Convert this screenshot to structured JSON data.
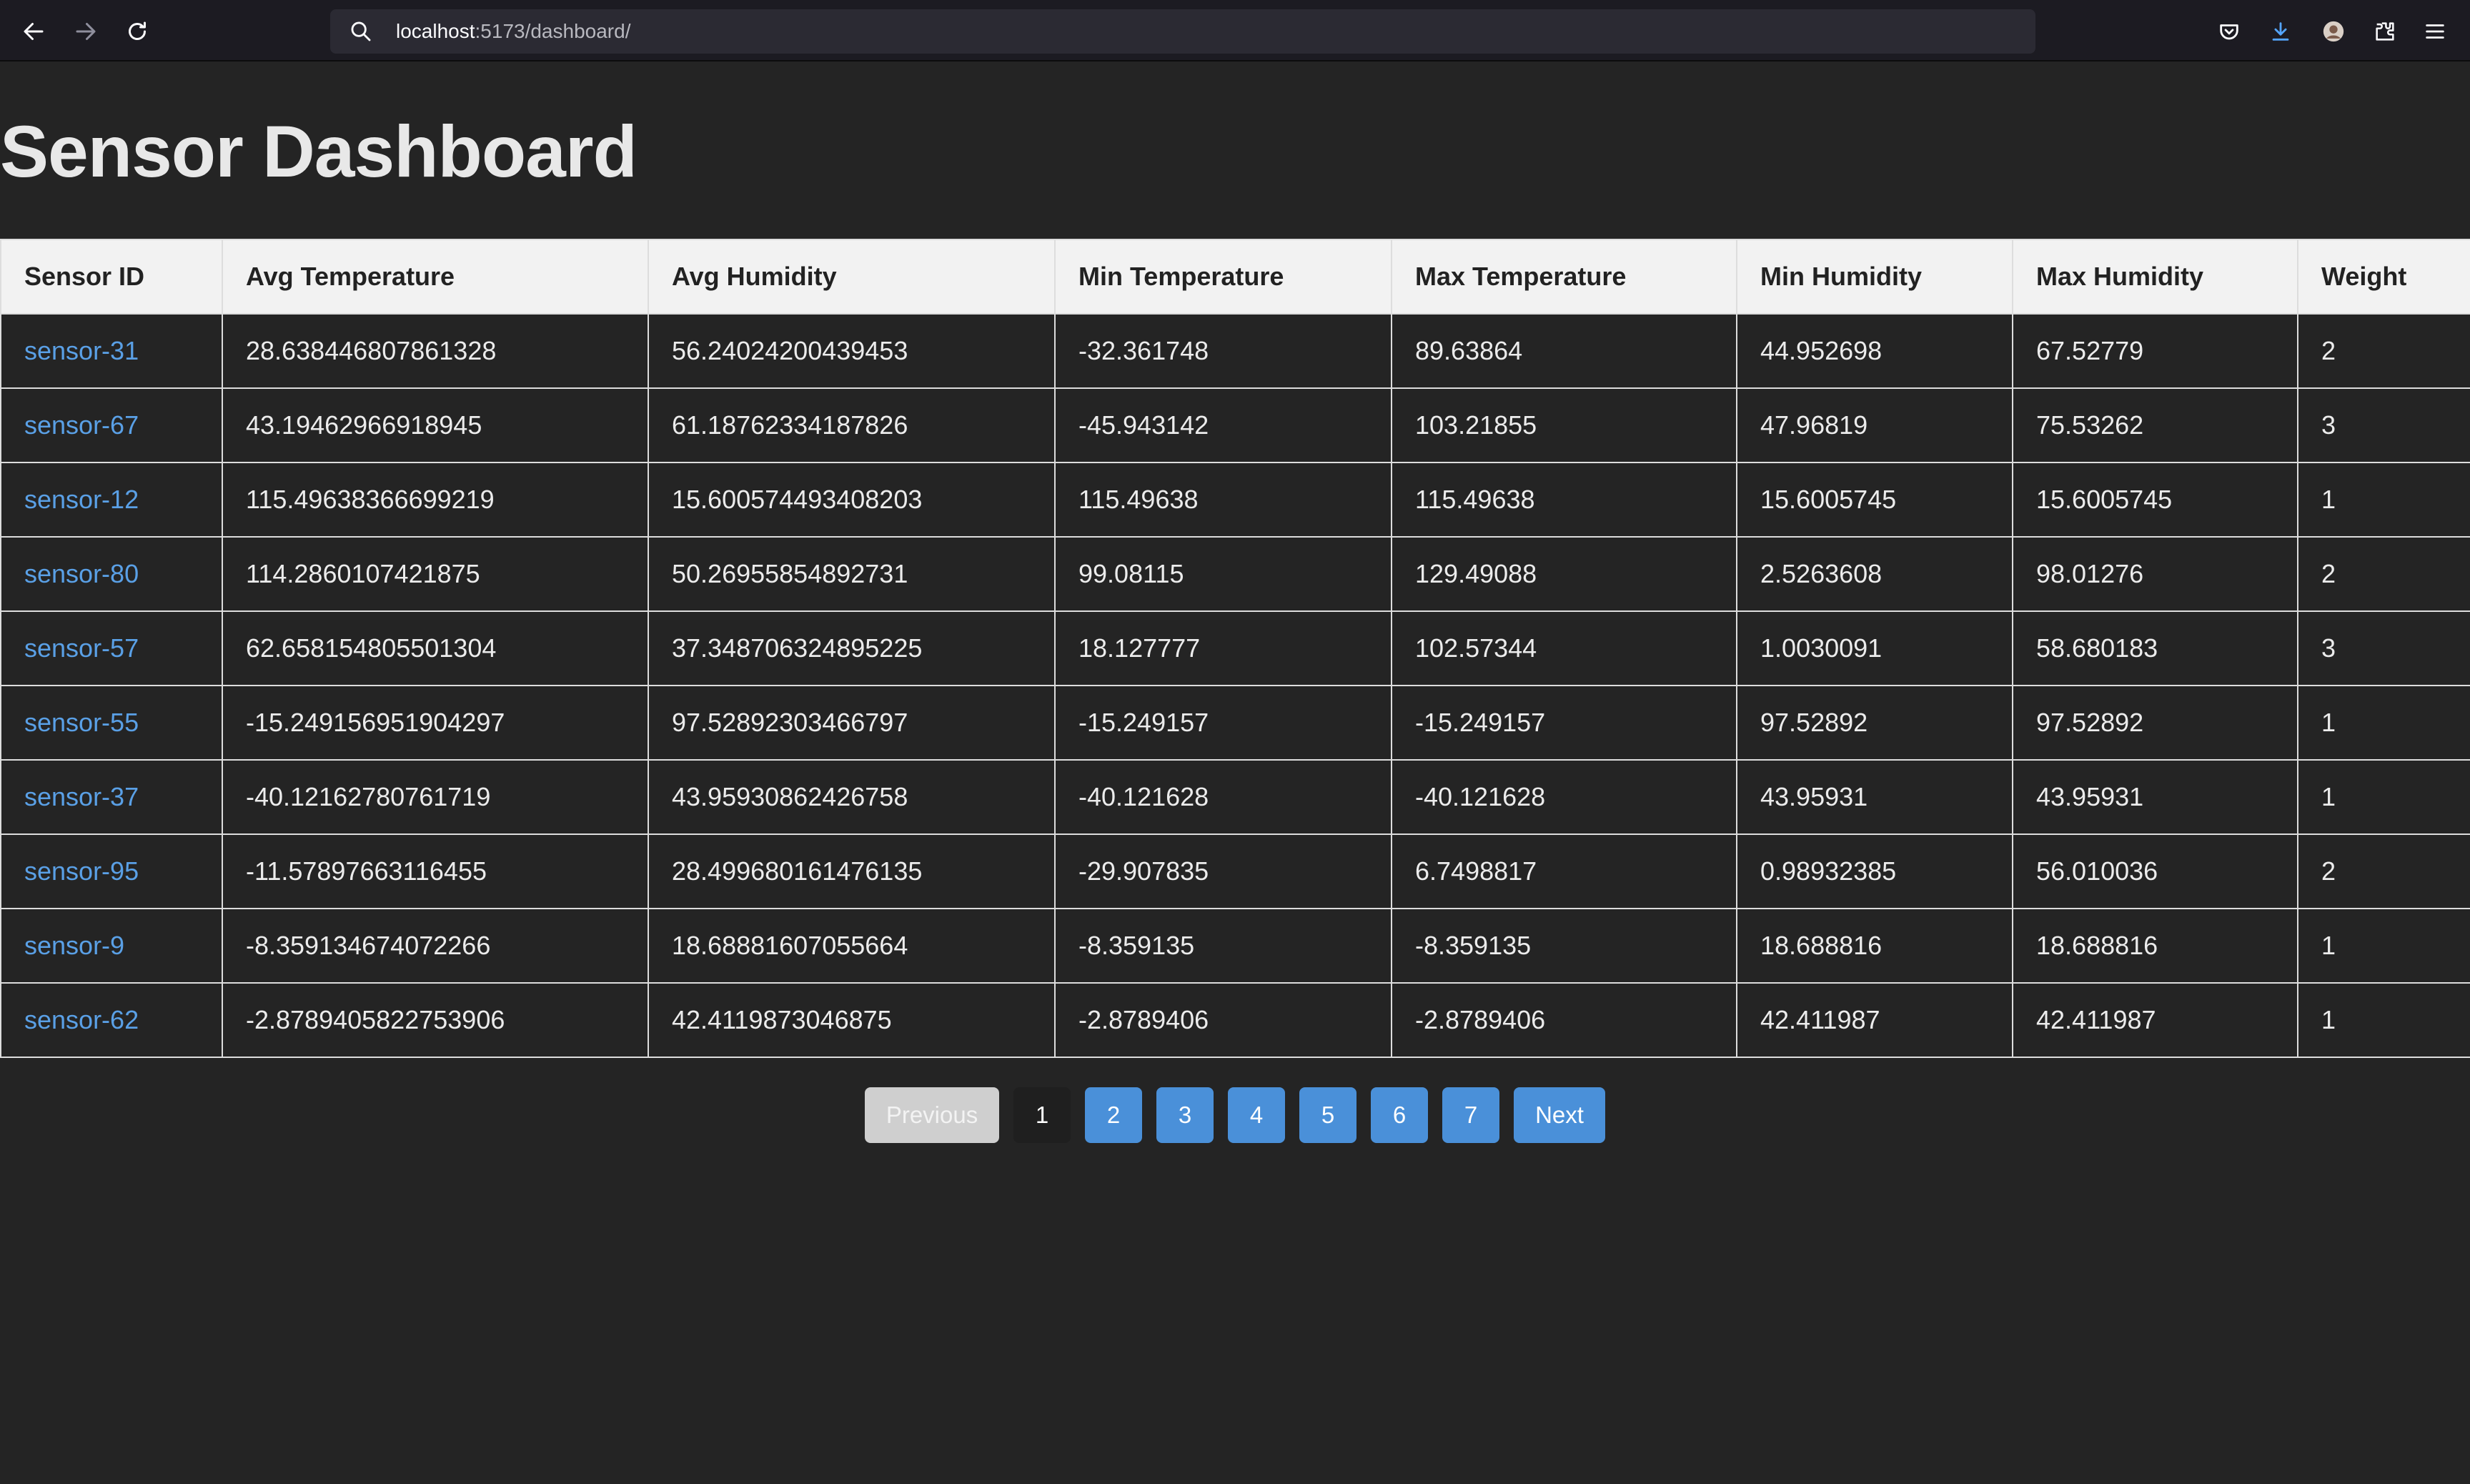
{
  "browser": {
    "url_host": "localhost",
    "url_path": ":5173/dashboard/"
  },
  "page": {
    "title": "Sensor Dashboard"
  },
  "table": {
    "headers": [
      "Sensor ID",
      "Avg Temperature",
      "Avg Humidity",
      "Min Temperature",
      "Max Temperature",
      "Min Humidity",
      "Max Humidity",
      "Weight"
    ],
    "rows": [
      [
        "sensor-31",
        "28.638446807861328",
        "56.24024200439453",
        "-32.361748",
        "89.63864",
        "44.952698",
        "67.52779",
        "2"
      ],
      [
        "sensor-67",
        "43.19462966918945",
        "61.18762334187826",
        "-45.943142",
        "103.21855",
        "47.96819",
        "75.53262",
        "3"
      ],
      [
        "sensor-12",
        "115.49638366699219",
        "15.600574493408203",
        "115.49638",
        "115.49638",
        "15.6005745",
        "15.6005745",
        "1"
      ],
      [
        "sensor-80",
        "114.2860107421875",
        "50.26955854892731",
        "99.08115",
        "129.49088",
        "2.5263608",
        "98.01276",
        "2"
      ],
      [
        "sensor-57",
        "62.658154805501304",
        "37.348706324895225",
        "18.127777",
        "102.57344",
        "1.0030091",
        "58.680183",
        "3"
      ],
      [
        "sensor-55",
        "-15.249156951904297",
        "97.52892303466797",
        "-15.249157",
        "-15.249157",
        "97.52892",
        "97.52892",
        "1"
      ],
      [
        "sensor-37",
        "-40.12162780761719",
        "43.95930862426758",
        "-40.121628",
        "-40.121628",
        "43.95931",
        "43.95931",
        "1"
      ],
      [
        "sensor-95",
        "-11.57897663116455",
        "28.499680161476135",
        "-29.907835",
        "6.7498817",
        "0.98932385",
        "56.010036",
        "2"
      ],
      [
        "sensor-9",
        "-8.359134674072266",
        "18.68881607055664",
        "-8.359135",
        "-8.359135",
        "18.688816",
        "18.688816",
        "1"
      ],
      [
        "sensor-62",
        "-2.8789405822753906",
        "42.4119873046875",
        "-2.8789406",
        "-2.8789406",
        "42.411987",
        "42.411987",
        "1"
      ]
    ]
  },
  "pagination": {
    "previous_label": "Previous",
    "next_label": "Next",
    "pages": [
      "1",
      "2",
      "3",
      "4",
      "5",
      "6",
      "7"
    ],
    "current_page": "1"
  },
  "icons": {
    "back": "back-arrow-icon",
    "forward": "forward-arrow-icon",
    "reload": "reload-icon",
    "search": "search-icon",
    "pocket": "pocket-icon",
    "downloads": "download-icon",
    "account": "account-avatar-icon",
    "extensions": "extensions-icon",
    "menu": "hamburger-menu-icon"
  },
  "colors": {
    "page_background": "#242424",
    "link": "#5aa0e6",
    "button_primary": "#4a90d9",
    "button_disabled": "#cfcfcf",
    "header_background": "#f2f2f2"
  }
}
